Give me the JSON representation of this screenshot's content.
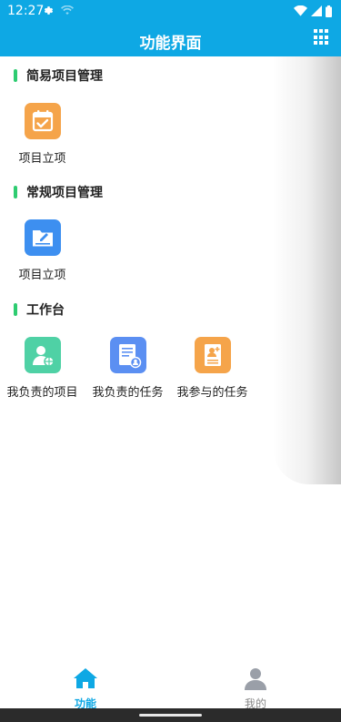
{
  "status_bar": {
    "time": "12:27"
  },
  "app_bar": {
    "title": "功能界面"
  },
  "sections": [
    {
      "title": "简易项目管理",
      "items": [
        {
          "label": "项目立项",
          "icon": "calendar-check-icon",
          "color": "#f5a44a"
        }
      ]
    },
    {
      "title": "常规项目管理",
      "items": [
        {
          "label": "项目立项",
          "icon": "folder-edit-icon",
          "color": "#3d8ff0"
        }
      ]
    },
    {
      "title": "工作台",
      "items": [
        {
          "label": "我负责的项目",
          "icon": "user-globe-icon",
          "color": "#4fd1a5"
        },
        {
          "label": "我负责的任务",
          "icon": "document-user-icon",
          "color": "#5b8ff2"
        },
        {
          "label": "我参与的任务",
          "icon": "contact-card-icon",
          "color": "#f5a44a"
        }
      ]
    }
  ],
  "bottom_nav": {
    "home_label": "功能",
    "mine_label": "我的"
  },
  "colors": {
    "primary": "#0ea8e4",
    "section_accent": "#2ecc71"
  }
}
